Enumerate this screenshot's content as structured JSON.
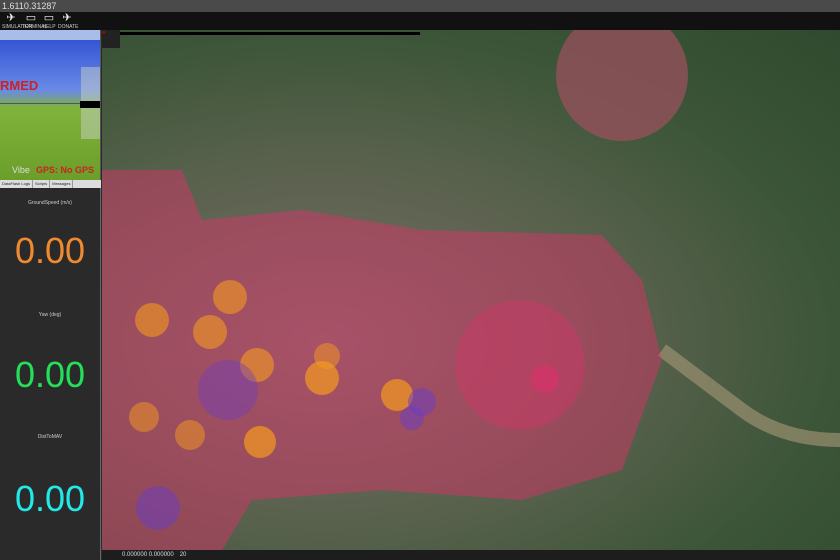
{
  "title": "1.6110.31287",
  "toolbar": [
    {
      "label": "SIMULATION",
      "icon": "plane-icon"
    },
    {
      "label": "TERMINAL",
      "icon": "monitor-icon"
    },
    {
      "label": "HELP",
      "icon": "help-monitor-icon"
    },
    {
      "label": "DONATE",
      "icon": "donate-plane-icon"
    }
  ],
  "hud": {
    "armed_text": "RMED",
    "vibe": "Vibe",
    "gps": "GPS: No GPS"
  },
  "tabs": [
    "DataFlash Logs",
    "Scripts",
    "Messages"
  ],
  "quick": [
    {
      "label": "GroundSpeed (m/s)",
      "value": "0.00",
      "color": "#f08a30"
    },
    {
      "label": "Yaw (deg)",
      "value": "0.00",
      "color": "#22e05a"
    },
    {
      "label": "DistToMAV",
      "value": "0.00",
      "color": "#22e8e8"
    }
  ],
  "status": {
    "coords": "0.000000 0.000000",
    "zoom": "20"
  },
  "colors": {
    "airspace": "#e0306a",
    "warning": "#f59a20",
    "restricted": "#6a3cc8"
  }
}
